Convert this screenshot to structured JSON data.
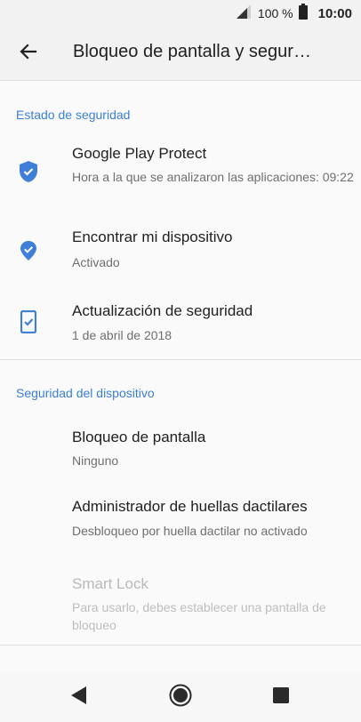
{
  "status_bar": {
    "battery_percent": "100 %",
    "time": "10:00"
  },
  "app_bar": {
    "title": "Bloqueo de pantalla y segur…",
    "back_icon": "arrow-back-icon"
  },
  "sections": [
    {
      "header": "Estado de seguridad",
      "items": [
        {
          "title": "Google Play Protect",
          "subtitle": "Hora a la que se analizaron las aplicaciones: 09:22",
          "icon": "shield-check-icon"
        },
        {
          "title": "Encontrar mi dispositivo",
          "subtitle": "Activado",
          "icon": "location-check-icon"
        },
        {
          "title": "Actualización de seguridad",
          "subtitle": "1 de abril de 2018",
          "icon": "phone-check-icon"
        }
      ]
    },
    {
      "header": "Seguridad del dispositivo",
      "items": [
        {
          "title": "Bloqueo de pantalla",
          "subtitle": "Ninguno"
        },
        {
          "title": "Administrador de huellas dactilares",
          "subtitle": "Desbloqueo por huella dactilar no activado"
        },
        {
          "title": "Smart Lock",
          "subtitle": "Para usarlo, debes establecer una pantalla de bloqueo",
          "disabled": true
        }
      ]
    }
  ],
  "nav_bar": {
    "back_icon": "nav-back-icon",
    "home_icon": "nav-home-icon",
    "recents_icon": "nav-recents-icon"
  },
  "colors": {
    "accent": "#3a7fdb",
    "icon_blue": "#3f7fd9"
  }
}
